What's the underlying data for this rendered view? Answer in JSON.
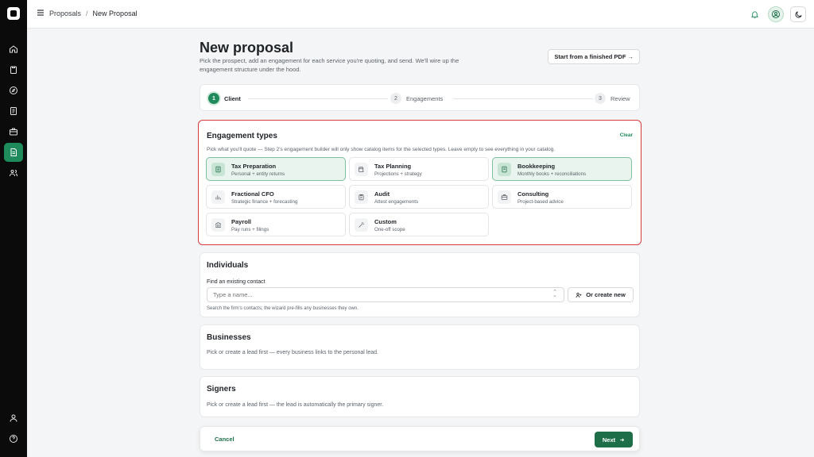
{
  "breadcrumb": {
    "root": "Proposals",
    "separator": "/",
    "current": "New Proposal"
  },
  "page": {
    "title": "New proposal",
    "description": "Pick the prospect, add an engagement for each service you're quoting, and send. We'll wire up the engagement structure under the hood.",
    "pdf_button": "Start from a finished PDF →"
  },
  "steps": [
    {
      "number": "1",
      "label": "Client"
    },
    {
      "number": "2",
      "label": "Engagements"
    },
    {
      "number": "3",
      "label": "Review"
    }
  ],
  "engagement_types": {
    "title": "Engagement types",
    "clear": "Clear",
    "hint": "Pick what you'll quote — Step 2's engagement builder will only show catalog items for the selected types. Leave empty to see everything in your catalog.",
    "items": [
      {
        "name": "Tax Preparation",
        "sub": "Personal + entity returns",
        "icon": "document-icon",
        "selected": true
      },
      {
        "name": "Tax Planning",
        "sub": "Projections + strategy",
        "icon": "calendar-icon",
        "selected": false
      },
      {
        "name": "Bookkeeping",
        "sub": "Monthly books + reconciliations",
        "icon": "book-icon",
        "selected": true
      },
      {
        "name": "Fractional CFO",
        "sub": "Strategic finance + forecasting",
        "icon": "chart-icon",
        "selected": false
      },
      {
        "name": "Audit",
        "sub": "Attest engagements",
        "icon": "clipboard-icon",
        "selected": false
      },
      {
        "name": "Consulting",
        "sub": "Project-based advice",
        "icon": "briefcase-icon",
        "selected": false
      },
      {
        "name": "Payroll",
        "sub": "Pay runs + filings",
        "icon": "bank-icon",
        "selected": false
      },
      {
        "name": "Custom",
        "sub": "One-off scope",
        "icon": "wand-icon",
        "selected": false
      }
    ]
  },
  "individuals": {
    "title": "Individuals",
    "find_label": "Find an existing contact",
    "placeholder": "Type a name...",
    "create_button": "Or create new",
    "help": "Search the firm's contacts; the wizard pre-fills any businesses they own."
  },
  "businesses": {
    "title": "Businesses",
    "desc": "Pick or create a lead first — every business links to the personal lead."
  },
  "signers": {
    "title": "Signers",
    "desc": "Pick or create a lead first — the lead is automatically the primary signer."
  },
  "footer": {
    "cancel": "Cancel",
    "next": "Next"
  },
  "colors": {
    "accent": "#1f8a5c",
    "accent_dark": "#1f6e4a",
    "highlight_border": "#d93a3a"
  }
}
